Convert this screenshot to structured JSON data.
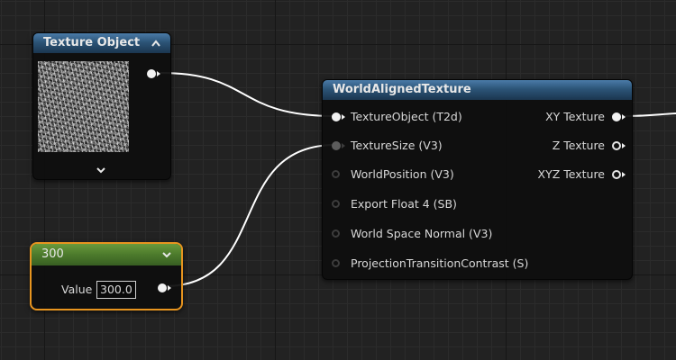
{
  "texture_object_node": {
    "title": "Texture Object",
    "collapse_icon": "chevron-up-icon",
    "expand_icon": "chevron-down-icon"
  },
  "constant_node": {
    "title": "300",
    "value_label": "Value",
    "value": "300.0",
    "selected": true,
    "accent_color": "#e8951f"
  },
  "world_aligned_node": {
    "title": "WorldAlignedTexture",
    "inputs": [
      {
        "label": "TextureObject (T2d)",
        "connected": true
      },
      {
        "label": "TextureSize (V3)",
        "connected": true
      },
      {
        "label": "WorldPosition (V3)",
        "connected": false
      },
      {
        "label": "Export Float 4 (SB)",
        "connected": false
      },
      {
        "label": "World Space Normal (V3)",
        "connected": false
      },
      {
        "label": "ProjectionTransitionContrast (S)",
        "connected": false
      }
    ],
    "outputs": [
      {
        "label": "XY Texture",
        "connected": true
      },
      {
        "label": "Z Texture",
        "connected": false
      },
      {
        "label": "XYZ Texture",
        "connected": false
      }
    ]
  },
  "colors": {
    "header_blue": "#2c5477",
    "header_green": "#4c7a2c",
    "wire": "#ffffff",
    "grid_background": "#222222"
  }
}
